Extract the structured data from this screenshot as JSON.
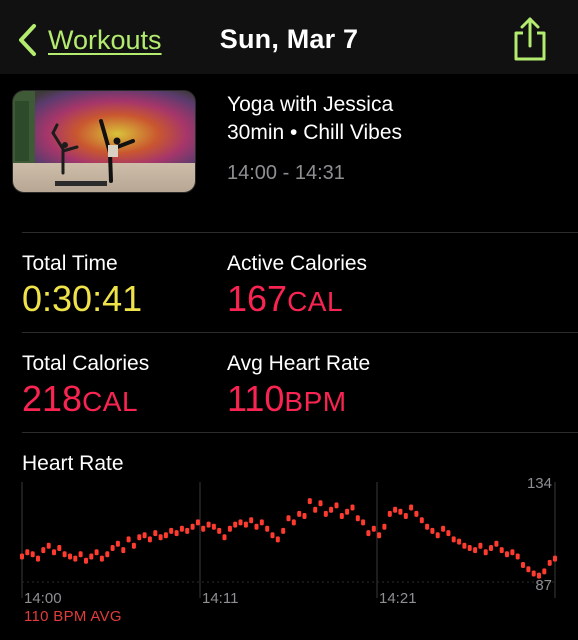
{
  "nav": {
    "back_label": "Workouts",
    "title": "Sun, Mar 7",
    "icons": {
      "back": "chevron-left-icon",
      "share": "share-icon"
    }
  },
  "workout": {
    "name": "Yoga with Jessica",
    "subtitle": "30min • Chill Vibes",
    "time_range": "14:00 - 14:31"
  },
  "metrics": {
    "total_time": {
      "label": "Total Time",
      "value": "0:30:41"
    },
    "active_calories": {
      "label": "Active Calories",
      "value": "167",
      "unit": "CAL"
    },
    "total_calories": {
      "label": "Total Calories",
      "value": "218",
      "unit": "CAL"
    },
    "avg_heart_rate": {
      "label": "Avg Heart Rate",
      "value": "110",
      "unit": "BPM"
    }
  },
  "colors": {
    "accent_green": "#b3ec6f",
    "yellow": "#f0e34a",
    "red": "#fa2452",
    "heart_rate_dots": "#ff3b30"
  },
  "heart_rate": {
    "title": "Heart Rate",
    "avg_label": "110 BPM AVG",
    "chart_data": {
      "type": "scatter",
      "x_ticks": [
        "14:00",
        "14:11",
        "14:21"
      ],
      "y_max_label": "134",
      "y_min_label": "87",
      "ylim": [
        87,
        134
      ],
      "points": [
        [
          14.0,
          99
        ],
        [
          14.03,
          101
        ],
        [
          14.06,
          100
        ],
        [
          14.09,
          98
        ],
        [
          14.12,
          102
        ],
        [
          14.15,
          104
        ],
        [
          14.18,
          101
        ],
        [
          14.21,
          103
        ],
        [
          14.24,
          100
        ],
        [
          14.27,
          99
        ],
        [
          14.3,
          98
        ],
        [
          14.33,
          100
        ],
        [
          14.36,
          97
        ],
        [
          14.39,
          99
        ],
        [
          14.42,
          101
        ],
        [
          14.45,
          98
        ],
        [
          14.48,
          100
        ],
        [
          14.51,
          103
        ],
        [
          14.54,
          105
        ],
        [
          14.57,
          102
        ],
        [
          14.6,
          107
        ],
        [
          14.63,
          104
        ],
        [
          14.66,
          108
        ],
        [
          14.69,
          109
        ],
        [
          14.72,
          107
        ],
        [
          14.75,
          110
        ],
        [
          14.78,
          108
        ],
        [
          14.81,
          109
        ],
        [
          14.84,
          111
        ],
        [
          14.87,
          110
        ],
        [
          14.9,
          112
        ],
        [
          14.93,
          111
        ],
        [
          14.96,
          113
        ],
        [
          14.99,
          115
        ],
        [
          15.02,
          112
        ],
        [
          15.05,
          114
        ],
        [
          15.08,
          113
        ],
        [
          15.11,
          111
        ],
        [
          15.14,
          108
        ],
        [
          15.17,
          112
        ],
        [
          15.2,
          114
        ],
        [
          15.23,
          115
        ],
        [
          15.26,
          114
        ],
        [
          15.29,
          116
        ],
        [
          15.32,
          113
        ],
        [
          15.35,
          115
        ],
        [
          15.38,
          112
        ],
        [
          15.41,
          109
        ],
        [
          15.44,
          107
        ],
        [
          15.47,
          111
        ],
        [
          15.5,
          117
        ],
        [
          15.53,
          115
        ],
        [
          15.56,
          119
        ],
        [
          15.59,
          118
        ],
        [
          15.62,
          125
        ],
        [
          15.65,
          121
        ],
        [
          15.68,
          124
        ],
        [
          15.71,
          119
        ],
        [
          15.74,
          121
        ],
        [
          15.77,
          123
        ],
        [
          15.8,
          118
        ],
        [
          15.83,
          120
        ],
        [
          15.86,
          122
        ],
        [
          15.89,
          117
        ],
        [
          15.92,
          115
        ],
        [
          15.95,
          110
        ],
        [
          15.98,
          112
        ],
        [
          16.01,
          109
        ],
        [
          16.04,
          113
        ],
        [
          16.07,
          119
        ],
        [
          16.1,
          121
        ],
        [
          16.13,
          120
        ],
        [
          16.16,
          118
        ],
        [
          16.19,
          122
        ],
        [
          16.22,
          119
        ],
        [
          16.25,
          116
        ],
        [
          16.28,
          113
        ],
        [
          16.31,
          111
        ],
        [
          16.34,
          109
        ],
        [
          16.37,
          112
        ],
        [
          16.4,
          110
        ],
        [
          16.43,
          107
        ],
        [
          16.46,
          106
        ],
        [
          16.49,
          104
        ],
        [
          16.52,
          103
        ],
        [
          16.55,
          102
        ],
        [
          16.58,
          104
        ],
        [
          16.61,
          101
        ],
        [
          16.64,
          103
        ],
        [
          16.67,
          105
        ],
        [
          16.7,
          102
        ],
        [
          16.73,
          100
        ],
        [
          16.76,
          101
        ],
        [
          16.79,
          99
        ],
        [
          16.82,
          95
        ],
        [
          16.85,
          93
        ],
        [
          16.88,
          91
        ],
        [
          16.91,
          90
        ],
        [
          16.94,
          92
        ],
        [
          16.97,
          96
        ],
        [
          17.0,
          98
        ]
      ]
    }
  }
}
